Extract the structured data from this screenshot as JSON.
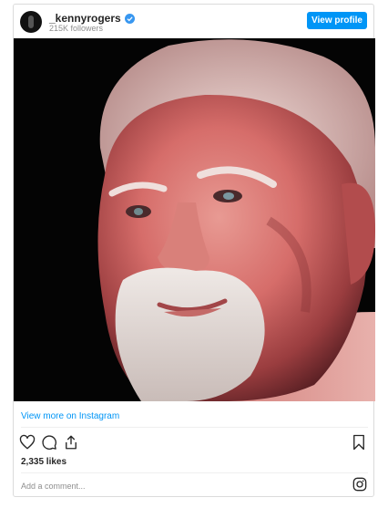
{
  "post": {
    "username": "_kennyrogers",
    "followers": "215K followers",
    "view_profile_label": "View profile",
    "view_more_label": "View more on Instagram",
    "likes": "2,335 likes",
    "comment_placeholder": "Add a comment..."
  },
  "icons": {
    "verified": "verified-badge-icon",
    "like": "heart-icon",
    "comment": "comment-bubble-icon",
    "share": "share-icon",
    "save": "bookmark-icon",
    "instagram": "instagram-logo-icon"
  },
  "colors": {
    "accent": "#0095f6",
    "text": "#262626",
    "muted": "#8e8e8e",
    "border": "#dbdbdb"
  }
}
